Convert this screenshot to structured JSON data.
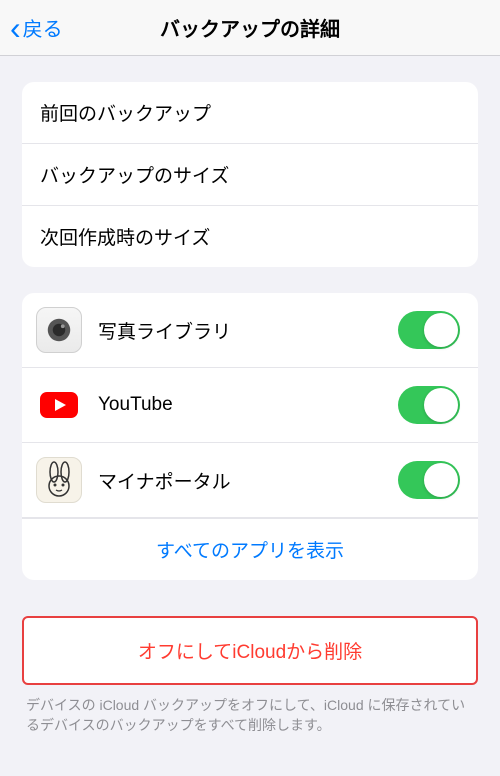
{
  "navbar": {
    "back_label": "戻る",
    "title": "バックアップの詳細"
  },
  "info": {
    "rows": [
      {
        "label": "前回のバックアップ"
      },
      {
        "label": "バックアップのサイズ"
      },
      {
        "label": "次回作成時のサイズ"
      }
    ]
  },
  "apps": {
    "items": [
      {
        "name": "写真ライブラリ",
        "icon": "photos-icon",
        "toggle": true
      },
      {
        "name": "YouTube",
        "icon": "youtube-icon",
        "toggle": true
      },
      {
        "name": "マイナポータル",
        "icon": "myna-icon",
        "toggle": true
      }
    ],
    "show_all_label": "すべてのアプリを表示"
  },
  "delete": {
    "button_label": "オフにしてiCloudから削除",
    "footer": "デバイスの iCloud バックアップをオフにして、iCloud に保存されているデバイスのバックアップをすべて削除します。"
  }
}
